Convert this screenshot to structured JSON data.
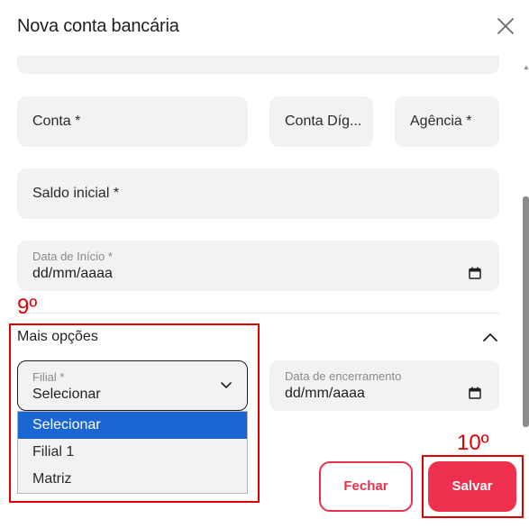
{
  "modal": {
    "title": "Nova conta bancária"
  },
  "fields": {
    "conta_label": "Conta *",
    "conta_digito_label": "Conta Díg...",
    "agencia_label": "Agência *",
    "saldo_inicial_label": "Saldo inicial *",
    "data_inicio_label": "Data de Início *",
    "data_inicio_value": "dd/mm/aaaa"
  },
  "mais_opcoes": {
    "label": "Mais opções",
    "filial_label": "Filial *",
    "filial_value": "Selecionar",
    "filial_options": [
      "Selecionar",
      "Filial 1",
      "Matriz"
    ],
    "data_encerramento_label": "Data de encerramento",
    "data_encerramento_value": "dd/mm/aaaa"
  },
  "annotations": {
    "step9": "9º",
    "step10": "10º"
  },
  "buttons": {
    "fechar": "Fechar",
    "salvar": "Salvar"
  },
  "colors": {
    "accent": "#ee2f4d",
    "annotation": "#e00000",
    "selected_option": "#1a66d2",
    "field_bg": "#f2f2f2"
  }
}
